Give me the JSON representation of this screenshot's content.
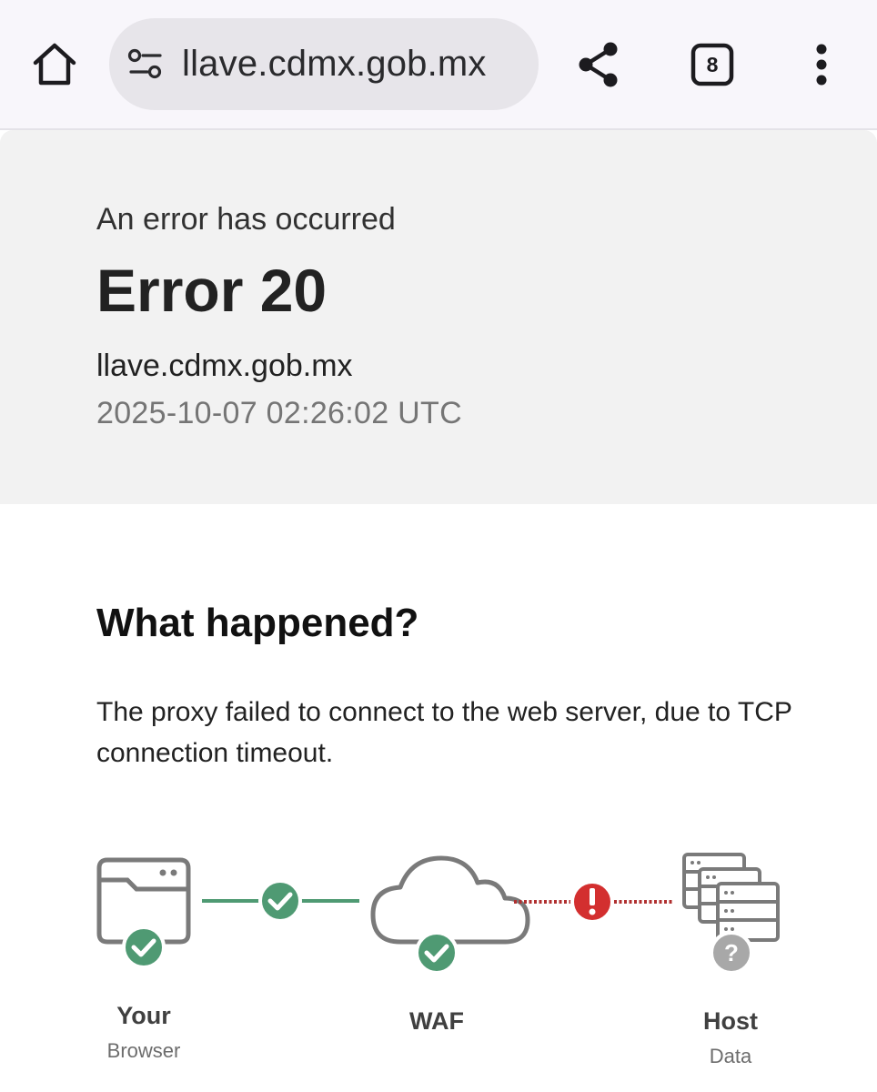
{
  "browser": {
    "url": "llave.cdmx.gob.mx",
    "tab_count": "8",
    "icons": [
      "home-icon",
      "site-settings-icon",
      "share-icon",
      "tab-switcher-icon",
      "more-menu-icon"
    ]
  },
  "error": {
    "subtitle": "An error has occurred",
    "title": "Error 20",
    "host": "llave.cdmx.gob.mx",
    "timestamp": "2025-10-07 02:26:02 UTC"
  },
  "what_happened": {
    "heading": "What happened?",
    "description": "The proxy failed to connect to the web server, due to TCP connection timeout."
  },
  "diagram": {
    "nodes": [
      {
        "label": "Your",
        "sublabel": "Browser",
        "status": "ok"
      },
      {
        "label": "WAF",
        "sublabel": "",
        "status": "ok"
      },
      {
        "label": "Host",
        "sublabel": "Data",
        "status": "unknown"
      }
    ],
    "links": [
      {
        "from": "Your Browser",
        "to": "WAF",
        "status": "ok"
      },
      {
        "from": "WAF",
        "to": "Host",
        "status": "error"
      }
    ],
    "colors": {
      "ok": "#4f9a73",
      "error": "#d32f2f",
      "unknown": "#a8a8a8",
      "icon": "#7a7a7a"
    }
  }
}
